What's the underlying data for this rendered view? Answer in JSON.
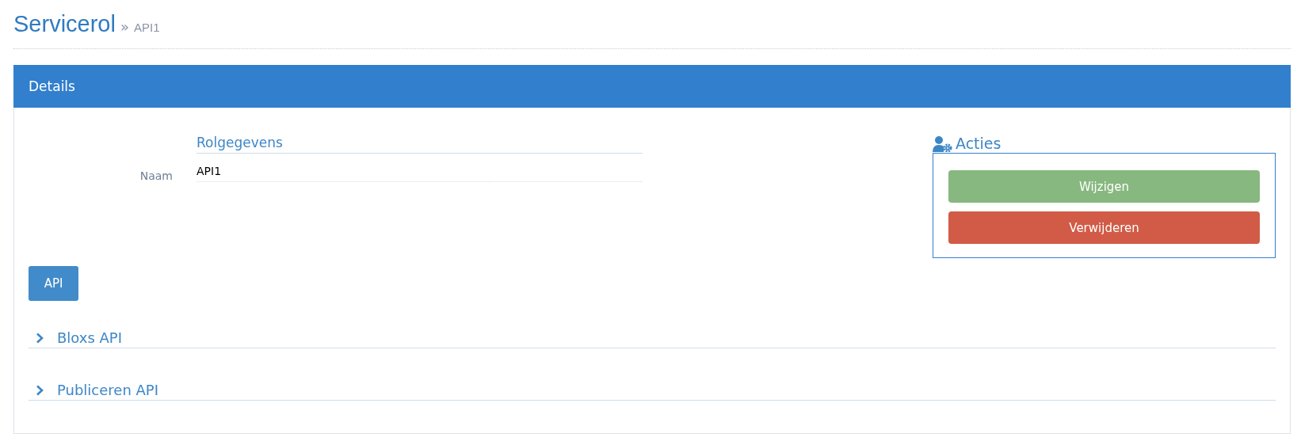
{
  "page": {
    "title": "Servicerol",
    "breadcrumb_separator": "»",
    "breadcrumb": "API1"
  },
  "panel": {
    "title": "Details",
    "form": {
      "section_title": "Rolgegevens",
      "fields": [
        {
          "label": "Naam",
          "value": "API1"
        }
      ]
    },
    "actions": {
      "title": "Acties",
      "buttons": [
        {
          "label": "Wijzigen",
          "kind": "success"
        },
        {
          "label": "Verwijderen",
          "kind": "danger"
        }
      ]
    },
    "button": {
      "label": "API"
    },
    "sections": [
      {
        "title": "Bloxs API",
        "expanded": false
      },
      {
        "title": "Publiceren API",
        "expanded": false
      }
    ]
  }
}
